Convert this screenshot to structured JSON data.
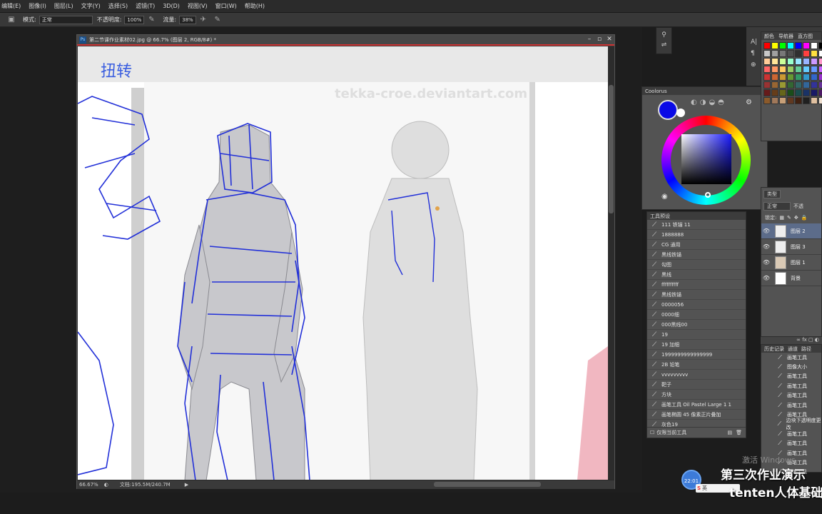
{
  "menu": [
    "编辑(E)",
    "图像(I)",
    "图层(L)",
    "文字(Y)",
    "选择(S)",
    "滤镜(T)",
    "3D(D)",
    "视图(V)",
    "窗口(W)",
    "帮助(H)"
  ],
  "options": {
    "mode_label": "模式:",
    "mode_value": "正常",
    "opacity_label": "不透明度:",
    "opacity_value": "100%",
    "flow_label": "流量:",
    "flow_value": "38%"
  },
  "document": {
    "title": "第二节课作业素材02.jpg @ 66.7% (图层 2, RGB/8#) *",
    "zoom": "66.67%",
    "doc_size": "文档:195.5M/240.7M",
    "canvas_note": "扭转",
    "canvas_credit": "tekka-croe.deviantart.com"
  },
  "coolorus": {
    "tab": "Coolorus",
    "fg_color": "#0a0ae6"
  },
  "swatch_tabs": [
    "颜色",
    "导航器",
    "直方图"
  ],
  "swatch_colors": [
    "#ff0000",
    "#ffff00",
    "#00ff00",
    "#00ffff",
    "#0000ff",
    "#ff00ff",
    "#ffffff",
    "#000000",
    "#c8c8c8",
    "#a0a0a0",
    "#787878",
    "#505050",
    "#303030",
    "#ff4040",
    "#ffe040",
    "#ffffff",
    "#ffcc99",
    "#ffe699",
    "#ccff99",
    "#99ffcc",
    "#99e6ff",
    "#99b3ff",
    "#cc99ff",
    "#ff99cc",
    "#ff6666",
    "#ff9966",
    "#ffcc66",
    "#99cc66",
    "#66cc99",
    "#66ccff",
    "#6699ff",
    "#cc66ff",
    "#cc3333",
    "#cc6633",
    "#cc9933",
    "#669933",
    "#339966",
    "#3399cc",
    "#3366cc",
    "#9933cc",
    "#993333",
    "#996633",
    "#999933",
    "#336633",
    "#336666",
    "#336699",
    "#333399",
    "#663399",
    "#661a1a",
    "#663d1a",
    "#66661a",
    "#1a4d1a",
    "#1a4d4d",
    "#1a3366",
    "#1a1a66",
    "#4d1a66",
    "#8b5a2b",
    "#a0785a",
    "#c8a078",
    "#603820",
    "#402010",
    "#202020",
    "#e0c0a0",
    "#f0e0d0"
  ],
  "tool_presets": {
    "tab": "工具预设",
    "items": [
      "111 铁锚 11",
      "1888888",
      "CG 通用",
      "黑线铁锚",
      "勾图",
      "黑线",
      "ffffffffff",
      "黑线铁锚",
      "0000056",
      "0000细",
      "000黑线00",
      "19",
      "19 加细",
      "1999999999999999",
      "2B 铅笔",
      "vvvvvvvvv",
      "靶子",
      "方块",
      "画笔工具  Oil Pastel Large 1 1",
      "画笔椭圆 45 像素正片叠加",
      "灰色19"
    ],
    "footer": "仅限当前工具"
  },
  "layers": {
    "kind": "类型",
    "blend": "正常",
    "opacity_label": "不透",
    "lock_label": "锁定:",
    "items": [
      "图层 2",
      "图层 3",
      "图层 1",
      "背景"
    ]
  },
  "history": {
    "tabs": [
      "历史记录",
      "通道",
      "路径"
    ],
    "items": [
      "画笔工具",
      "图像大小",
      "画笔工具",
      "画笔工具",
      "画笔工具",
      "画笔工具",
      "画笔工具",
      "边块下透明度更改",
      "画笔工具",
      "画笔工具",
      "画笔工具",
      "画笔工具",
      "画笔工具"
    ]
  },
  "overlay": {
    "watermark": "激活 Windows",
    "caption1": "第三次作业演示",
    "caption2": "tenten人体基础",
    "clock": "22:01",
    "ime": "英"
  }
}
